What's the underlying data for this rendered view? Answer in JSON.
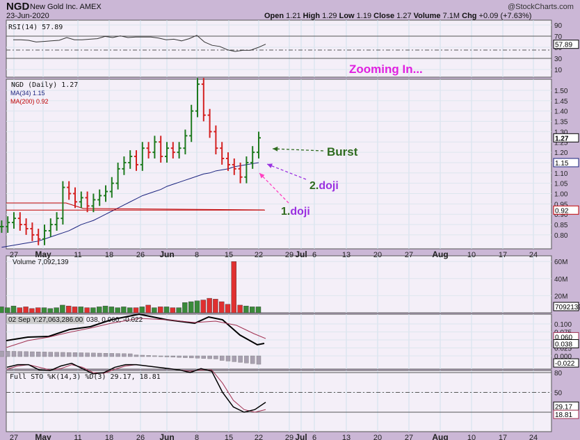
{
  "header": {
    "symbol": "NGD",
    "name": "New Gold Inc. AMEX",
    "date": "23-Jun-2020",
    "credit": "@StockCharts.com",
    "quote": [
      [
        "Open",
        "1.21"
      ],
      [
        "High",
        "1.29"
      ],
      [
        "Low",
        "1.19"
      ],
      [
        "Close",
        "1.27"
      ],
      [
        "Volume",
        "7.1M"
      ],
      [
        "Chg",
        "+0.09 (+7.63%)"
      ]
    ]
  },
  "annotations": {
    "zoom": "Zooming In...",
    "burst": "Burst",
    "doji2_num": "2.",
    "doji2": "doji",
    "doji1_num": "1.",
    "doji1": "doji"
  },
  "colors": {
    "up": "#1e7a1e",
    "down": "#d42020",
    "ma34": "#1a237e",
    "ma200": "#c00000",
    "magenta": "#e020e0",
    "burstGreen": "#2e6b1e",
    "purple": "#9a30e0",
    "pink": "#ff40c0"
  },
  "chart_data": {
    "type": "ohlc",
    "price_panel": {
      "legend": "NGD (Daily) 1.27",
      "ma34_label": "MA(34) 1.15",
      "ma200_label": "MA(200) 0.92",
      "yticks": [
        "1.50",
        "1.45",
        "1.40",
        "1.35",
        "1.30",
        "1.25",
        "1.20",
        "1.15",
        "1.10",
        "1.05",
        "1.00",
        "0.95",
        "0.90",
        "0.85",
        "0.80"
      ],
      "ylim": [
        0.75,
        1.55
      ],
      "closes": [
        0.84,
        0.86,
        0.88,
        0.85,
        0.83,
        0.8,
        0.78,
        0.82,
        0.85,
        0.88,
        1.03,
        1.0,
        0.96,
        0.98,
        0.94,
        0.97,
        0.99,
        1.01,
        1.05,
        1.12,
        1.15,
        1.18,
        1.14,
        1.22,
        1.2,
        1.25,
        1.18,
        1.22,
        1.2,
        1.22,
        1.28,
        1.4,
        1.53,
        1.38,
        1.3,
        1.22,
        1.17,
        1.14,
        1.12,
        1.08,
        1.15,
        1.2,
        1.27
      ],
      "ma34": [
        0.74,
        0.745,
        0.75,
        0.755,
        0.76,
        0.765,
        0.77,
        0.78,
        0.79,
        0.8,
        0.81,
        0.82,
        0.835,
        0.85,
        0.86,
        0.87,
        0.885,
        0.9,
        0.915,
        0.93,
        0.945,
        0.96,
        0.975,
        0.99,
        1.0,
        1.01,
        1.02,
        1.035,
        1.045,
        1.055,
        1.065,
        1.075,
        1.085,
        1.095,
        1.1,
        1.11,
        1.115,
        1.12,
        1.13,
        1.135,
        1.14,
        1.145,
        1.15
      ],
      "ma200": 0.92,
      "last_tags": [
        "1.27",
        "1.15",
        "0.92"
      ]
    },
    "rsi": {
      "label": "RSI(14) 57.89",
      "yticks": [
        "90",
        "70",
        "50",
        "30",
        "10"
      ],
      "tag": "57.89",
      "values": [
        66,
        66,
        65,
        62,
        63,
        64,
        65,
        70,
        66,
        66,
        67,
        68,
        72,
        70,
        73,
        70,
        71,
        71,
        71,
        69,
        66,
        67,
        64,
        68,
        74,
        62,
        56,
        54,
        48,
        45,
        47,
        47,
        52,
        58
      ]
    },
    "volume": {
      "label": "Volume 7,092,139",
      "yticks": [
        "60M",
        "40M",
        "20M"
      ],
      "tag": "7092139",
      "values": [
        7,
        6,
        8,
        6,
        7,
        5,
        6,
        6,
        5,
        6,
        9,
        8,
        7,
        7,
        6,
        6,
        7,
        8,
        7,
        6,
        7,
        6,
        6,
        7,
        9,
        6,
        7,
        7,
        6,
        6,
        12,
        13,
        14,
        15,
        17,
        16,
        13,
        10,
        60,
        9,
        8,
        7,
        7
      ]
    },
    "macd": {
      "label_hover": "02 Sep Y:27,063,286.00",
      "label": "038, 0.060, -0.022",
      "yticks": [
        "0.100",
        "0.075",
        "0.050",
        "0.025",
        "0.000"
      ],
      "tags": [
        "0.060",
        "0.038",
        "-0.022"
      ]
    },
    "sto": {
      "label": "Full STO %K(14,3) %D(3) 29.17, 18.81",
      "yticks": [
        "80",
        "50"
      ],
      "tags": [
        "29.17",
        "18.81"
      ],
      "k": [
        88,
        92,
        92,
        84,
        83,
        90,
        94,
        86,
        78,
        80,
        88,
        92,
        92,
        90,
        88,
        86,
        84,
        80,
        86,
        82,
        50,
        28,
        20,
        24,
        35
      ],
      "d": [
        85,
        90,
        92,
        88,
        84,
        86,
        92,
        88,
        80,
        79,
        85,
        90,
        92,
        90,
        88,
        86,
        84,
        82,
        84,
        84,
        64,
        38,
        24,
        20,
        24
      ]
    },
    "xticks": [
      "27",
      "May",
      "11",
      "18",
      "26",
      "Jun",
      "8",
      "15",
      "22",
      "29",
      "Jul",
      "6",
      "13",
      "20",
      "27",
      "Aug",
      "10",
      "17",
      "24"
    ]
  }
}
